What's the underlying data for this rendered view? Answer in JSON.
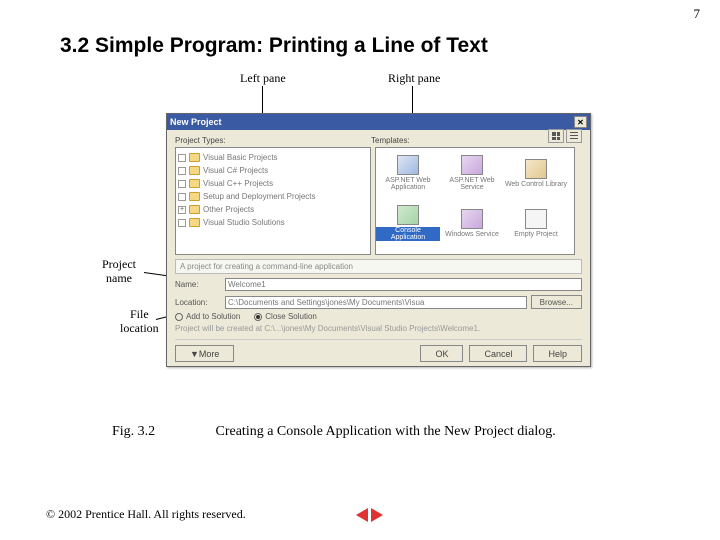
{
  "page": {
    "number": "7"
  },
  "heading": "3.2 Simple Program: Printing a Line of Text",
  "annotations": {
    "left_pane": "Left pane",
    "right_pane": "Right pane",
    "project_name": "Project\nname",
    "file_location": "File\nlocation"
  },
  "dialog": {
    "title": "New Project",
    "labels": {
      "project_types": "Project Types:",
      "templates": "Templates:"
    },
    "project_types": [
      "Visual Basic Projects",
      "Visual C# Projects",
      "Visual C++ Projects",
      "Setup and Deployment Projects",
      "Other Projects",
      "Visual Studio Solutions"
    ],
    "templates": [
      {
        "label": "ASP.NET Web Application",
        "ico": "web"
      },
      {
        "label": "ASP.NET Web Service",
        "ico": "svc"
      },
      {
        "label": "Web Control Library",
        "ico": "lib"
      },
      {
        "label": "Console Application",
        "ico": "",
        "selected": true
      },
      {
        "label": "Windows Service",
        "ico": "svc"
      },
      {
        "label": "Empty Project",
        "ico": "empty"
      }
    ],
    "description": "A project for creating a command-line application",
    "name_label": "Name:",
    "name_value": "Welcome1",
    "location_label": "Location:",
    "location_value": "C:\\Documents and Settings\\jones\\My Documents\\Visua",
    "browse": "Browse...",
    "radio_add": "Add to Solution",
    "radio_close": "Close Solution",
    "hint": "Project will be created at C:\\...\\jones\\My Documents\\Visual Studio Projects\\Welcome1.",
    "more": "▼More",
    "ok": "OK",
    "cancel": "Cancel",
    "help": "Help"
  },
  "figure": {
    "num": "Fig. 3.2",
    "caption": "Creating a Console Application with the New Project dialog."
  },
  "footer": {
    "copyright": "© 2002 Prentice Hall. All rights reserved."
  }
}
